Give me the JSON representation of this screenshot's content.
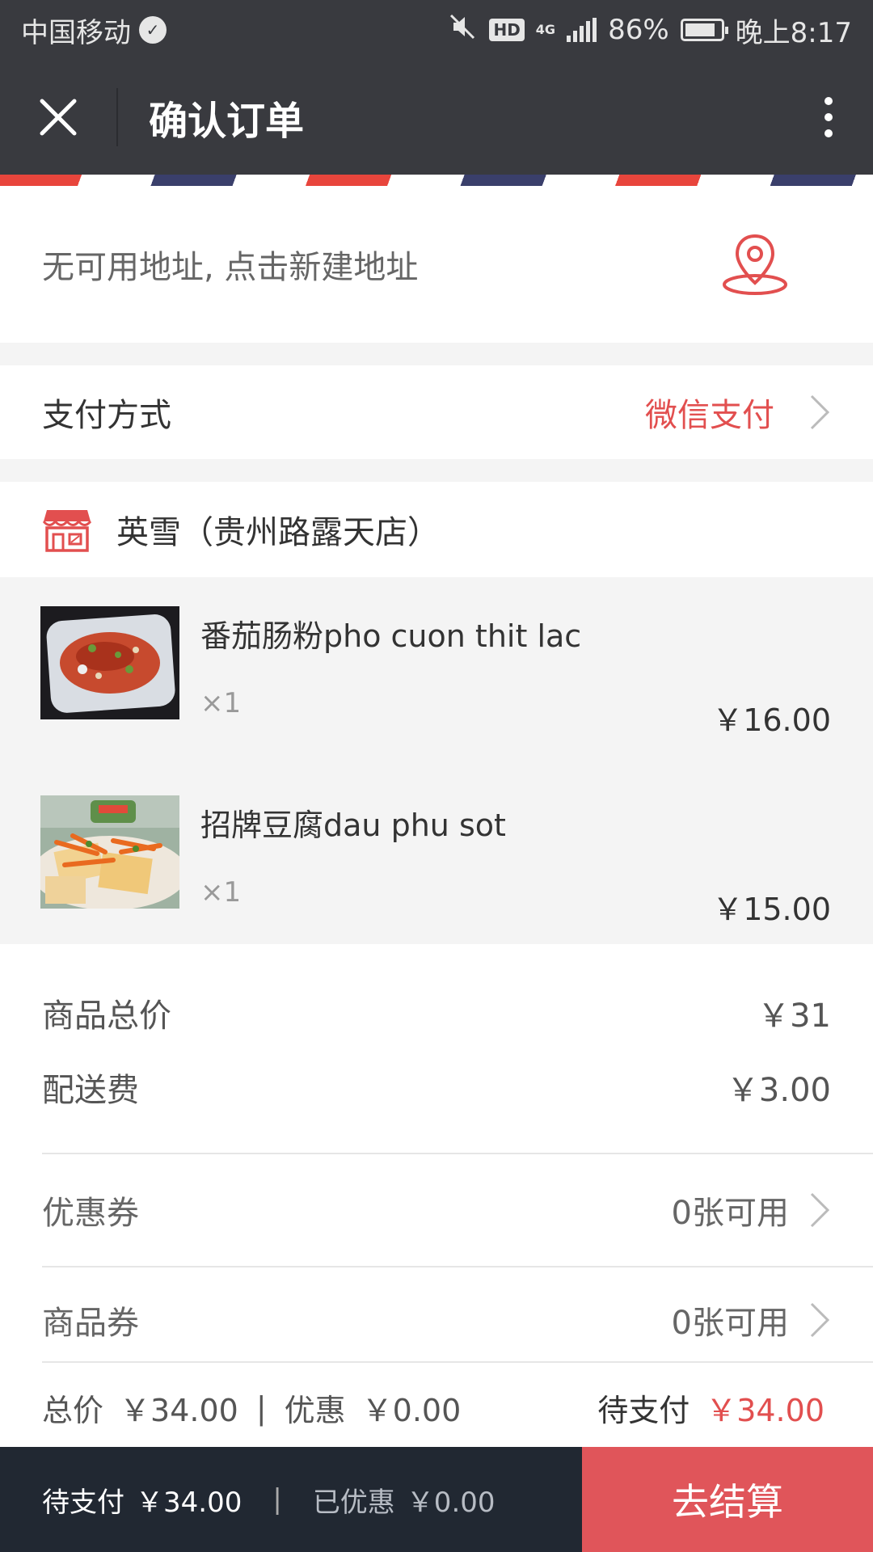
{
  "status_bar": {
    "carrier": "中国移动",
    "hd": "HD",
    "network": "4G",
    "battery": "86%",
    "battery_level": 0.86,
    "time": "晚上8:17"
  },
  "header": {
    "title": "确认订单",
    "icons": {
      "close": "close-icon",
      "more": "more-vertical-icon"
    }
  },
  "address": {
    "text": "无可用地址, 点击新建地址",
    "icon": "location-pin-icon"
  },
  "payment": {
    "label": "支付方式",
    "value": "微信支付"
  },
  "store": {
    "name": "英雪（贵州路露天店）",
    "icon": "store-icon"
  },
  "items": [
    {
      "name": "番茄肠粉pho cuon thit lac",
      "qty": "×1",
      "price": "￥16.00"
    },
    {
      "name": "招牌豆腐dau phu sot",
      "qty": "×1",
      "price": "￥15.00"
    }
  ],
  "summary": {
    "subtotal_label": "商品总价",
    "subtotal_value": "￥31",
    "delivery_label": "配送费",
    "delivery_value": "￥3.00",
    "coupon_label": "优惠券",
    "coupon_value": "0张可用",
    "voucher_label": "商品券",
    "voucher_value": "0张可用",
    "total_label": "总价",
    "total_value": "￥34.00",
    "separator": "|",
    "discount_label": "优惠",
    "discount_value": "￥0.00",
    "due_label": "待支付",
    "due_value": "￥34.00"
  },
  "bottom_bar": {
    "due_label": "待支付",
    "due_value": "￥34.00",
    "separator": "|",
    "saved_label": "已优惠",
    "saved_value": "￥0.00",
    "checkout_label": "去结算"
  },
  "colors": {
    "header_bg": "#393a3f",
    "accent_red": "#e24f4f",
    "checkout_bg": "#e0555a",
    "bottom_bar_bg": "#212832"
  }
}
